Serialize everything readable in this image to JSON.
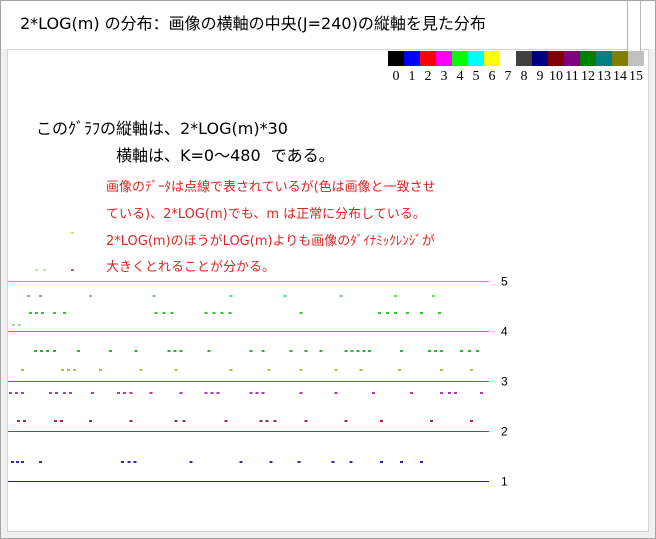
{
  "window": {
    "title": "2*LOG(m) の分布：画像の横軸の中央(J=240)の縦軸を見た分布"
  },
  "palette": {
    "swatches": [
      {
        "label": "0",
        "color": "#000000"
      },
      {
        "label": "1",
        "color": "#0000ff"
      },
      {
        "label": "2",
        "color": "#ff0000"
      },
      {
        "label": "3",
        "color": "#ff00ff"
      },
      {
        "label": "4",
        "color": "#00ff00"
      },
      {
        "label": "5",
        "color": "#00ffff"
      },
      {
        "label": "6",
        "color": "#ffff00"
      },
      {
        "label": "7",
        "color": "#ffffff"
      },
      {
        "label": "8",
        "color": "#404040"
      },
      {
        "label": "9",
        "color": "#000080"
      },
      {
        "label": "10",
        "color": "#800000"
      },
      {
        "label": "11",
        "color": "#800080"
      },
      {
        "label": "12",
        "color": "#008000"
      },
      {
        "label": "13",
        "color": "#008080"
      },
      {
        "label": "14",
        "color": "#808000"
      },
      {
        "label": "15",
        "color": "#c0c0c0"
      }
    ]
  },
  "description": {
    "line1": "このｸﾞﾗﾌの縦軸は、2*LOG(m)*30",
    "line2": "横軸は、K=0～480  である。"
  },
  "note": {
    "color": "#e02424",
    "lines": [
      "画像のﾃﾞｰﾀは点線で表されているが(色は画像と一致させ",
      "ている)、2*LOG(m)でも、m は正常に分布している。",
      "2*LOG(m)のほうがLOG(m)よりも画像のﾀﾞｲﾅﾐｯｸﾚﾝｼﾞが",
      "大きくとれることが分かる。"
    ]
  },
  "chart_data": {
    "type": "scatter",
    "xlim": [
      0,
      480
    ],
    "ylim": [
      0,
      9.6
    ],
    "grid": false,
    "reference_lines": [
      {
        "value": 1,
        "label": "1",
        "color": "#20207a"
      },
      {
        "value": 2,
        "label": "2",
        "color": "#d01e44"
      },
      {
        "value": 3,
        "label": "3",
        "color": "#c02cc0"
      },
      {
        "value": 4,
        "label": "4",
        "color": "#2cc42c"
      },
      {
        "value": 5,
        "label": "5",
        "color": "#2cd4d4"
      }
    ],
    "series": [
      {
        "color": "#e0e040",
        "y": 5.96,
        "x": [
          64
        ]
      },
      {
        "color": "#bfe3a0",
        "y": 5.22,
        "x": [
          28,
          36,
          224
        ]
      },
      {
        "color": "#e05050",
        "y": 5.22,
        "x": [
          64
        ]
      },
      {
        "color": "#6ccc6c",
        "y": 4.7,
        "x": [
          20,
          32,
          82,
          145,
          222,
          276,
          332,
          386,
          424
        ]
      },
      {
        "color": "#3cc03c",
        "y": 4.36,
        "x": [
          22,
          28,
          34,
          46,
          56,
          147,
          155,
          163,
          197,
          205,
          213,
          221,
          292,
          370,
          378,
          386,
          398,
          412,
          430
        ]
      },
      {
        "color": "#a6d8a6",
        "y": 4.12,
        "x": [
          5,
          11
        ]
      },
      {
        "color": "#2eb02e",
        "y": 3.6,
        "x": [
          27,
          33,
          39,
          46,
          70,
          102,
          127,
          160,
          166,
          172,
          200,
          242,
          254,
          282,
          297,
          312,
          337,
          343,
          349,
          355,
          360,
          392,
          420,
          426,
          432,
          452,
          460,
          468
        ]
      },
      {
        "color": "#a8c43c",
        "y": 3.22,
        "x": [
          14,
          54,
          60,
          66,
          92,
          132,
          167,
          222,
          260,
          292,
          327,
          352,
          390,
          432,
          462
        ]
      },
      {
        "color": "#b03cb0",
        "y": 2.76,
        "x": [
          2,
          8,
          14,
          42,
          48,
          56,
          62,
          84,
          110,
          116,
          122,
          142,
          172,
          197,
          203,
          209,
          242,
          248,
          254,
          292,
          327,
          364,
          402,
          432,
          440,
          446,
          472
        ]
      },
      {
        "color": "#a02850",
        "y": 2.2,
        "x": [
          10,
          16,
          47,
          53,
          82,
          122,
          167,
          175,
          217,
          252,
          258,
          266,
          297,
          337,
          372,
          422,
          462
        ]
      },
      {
        "color": "#2828c0",
        "y": 1.38,
        "x": [
          4,
          9,
          14,
          32,
          114,
          120,
          126,
          182,
          232,
          262,
          290,
          324,
          342,
          372,
          392,
          412
        ]
      }
    ]
  }
}
